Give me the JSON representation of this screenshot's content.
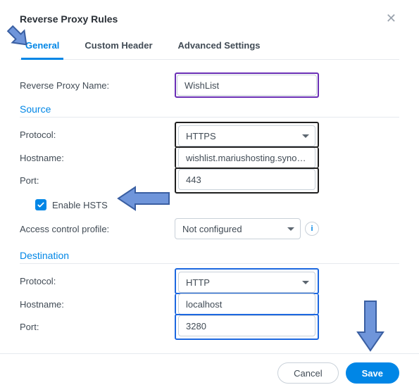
{
  "dialog": {
    "title": "Reverse Proxy Rules"
  },
  "tabs": {
    "general": "General",
    "custom_header": "Custom Header",
    "advanced": "Advanced Settings"
  },
  "fields": {
    "name_label": "Reverse Proxy Name:",
    "name_value": "WishList"
  },
  "sections": {
    "source": "Source",
    "destination": "Destination"
  },
  "source": {
    "protocol_label": "Protocol:",
    "protocol_value": "HTTPS",
    "hostname_label": "Hostname:",
    "hostname_value": "wishlist.mariushosting.synology.me",
    "port_label": "Port:",
    "port_value": "443",
    "hsts_label": "Enable HSTS",
    "acp_label": "Access control profile:",
    "acp_value": "Not configured"
  },
  "destination": {
    "protocol_label": "Protocol:",
    "protocol_value": "HTTP",
    "hostname_label": "Hostname:",
    "hostname_value": "localhost",
    "port_label": "Port:",
    "port_value": "3280"
  },
  "footer": {
    "cancel": "Cancel",
    "save": "Save"
  }
}
